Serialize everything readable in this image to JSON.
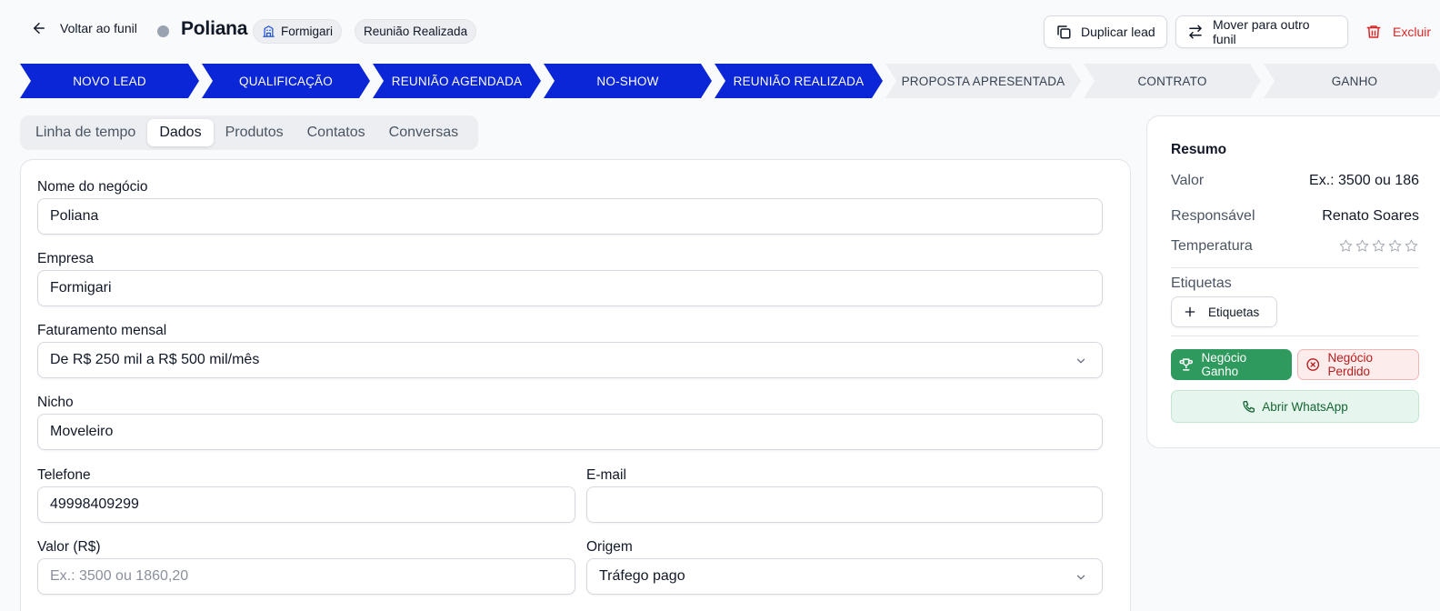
{
  "header": {
    "back_label": "Voltar ao funil",
    "lead_name": "Poliana",
    "company_chip": "Formigari",
    "stage_chip": "Reunião Realizada",
    "duplicate_label": "Duplicar lead",
    "move_label": "Mover para outro funil",
    "delete_label": "Excluir"
  },
  "pipeline": {
    "stages": [
      {
        "label": "NOVO LEAD",
        "status": "done"
      },
      {
        "label": "QUALIFICAÇÃO",
        "status": "done"
      },
      {
        "label": "REUNIÃO AGENDADA",
        "status": "done"
      },
      {
        "label": "NO-SHOW",
        "status": "done"
      },
      {
        "label": "REUNIÃO REALIZADA",
        "status": "done"
      },
      {
        "label": "PROPOSTA APRESENTADA",
        "status": "todo"
      },
      {
        "label": "CONTRATO",
        "status": "todo"
      },
      {
        "label": "GANHO",
        "status": "todo"
      }
    ]
  },
  "tabs": [
    {
      "label": "Linha de tempo",
      "active": false
    },
    {
      "label": "Dados",
      "active": true
    },
    {
      "label": "Produtos",
      "active": false
    },
    {
      "label": "Contatos",
      "active": false
    },
    {
      "label": "Conversas",
      "active": false
    }
  ],
  "form": {
    "deal_name": {
      "label": "Nome do negócio",
      "value": "Poliana"
    },
    "company": {
      "label": "Empresa",
      "value": "Formigari"
    },
    "revenue": {
      "label": "Faturamento mensal",
      "value": "De R$ 250 mil a R$ 500 mil/mês"
    },
    "niche": {
      "label": "Nicho",
      "value": "Moveleiro"
    },
    "phone": {
      "label": "Telefone",
      "value": "49998409299"
    },
    "email": {
      "label": "E-mail",
      "value": ""
    },
    "value": {
      "label": "Valor (R$)",
      "value": "",
      "placeholder": "Ex.: 3500 ou 1860,20"
    },
    "origin": {
      "label": "Origem",
      "value": "Tráfego pago"
    }
  },
  "summary": {
    "title": "Resumo",
    "value_label": "Valor",
    "value": "Ex.: 3500 ou 186",
    "owner_label": "Responsável",
    "owner": "Renato Soares",
    "temperature_label": "Temperatura",
    "temperature": 0,
    "temperature_max": 5,
    "tags_label": "Etiquetas",
    "add_tags_label": "Etiquetas",
    "won_label": "Negócio Ganho",
    "lost_label": "Negócio Perdido",
    "whatsapp_label": "Abrir WhatsApp"
  },
  "colors": {
    "stage_done": "#0a26d6",
    "stage_todo": "#eceef1",
    "won": "#2f9a5e",
    "lost": "#b91c1c",
    "delete": "#dc2626"
  }
}
